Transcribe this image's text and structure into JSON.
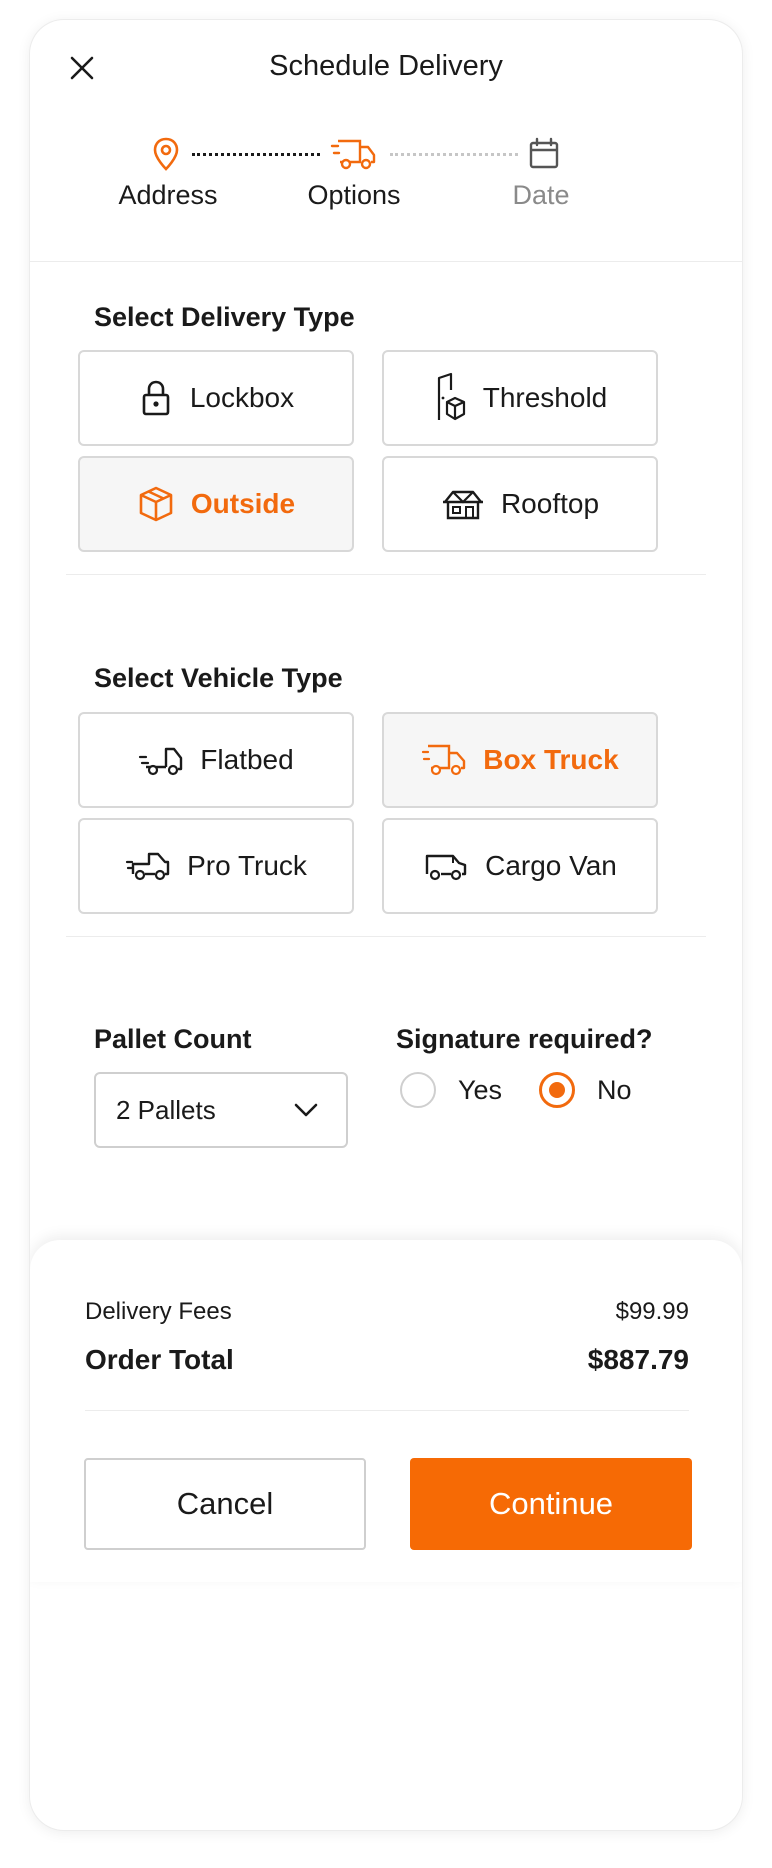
{
  "header": {
    "title": "Schedule Delivery",
    "steps": [
      {
        "label": "Address",
        "state": "done",
        "icon": "location-pin-icon"
      },
      {
        "label": "Options",
        "state": "active",
        "icon": "delivery-truck-icon"
      },
      {
        "label": "Date",
        "state": "upcoming",
        "icon": "calendar-icon"
      }
    ]
  },
  "delivery_type": {
    "title": "Select Delivery Type",
    "options": [
      {
        "label": "Lockbox",
        "icon": "lock-icon",
        "selected": false
      },
      {
        "label": "Threshold",
        "icon": "door-package-icon",
        "selected": false
      },
      {
        "label": "Outside",
        "icon": "package-icon",
        "selected": true
      },
      {
        "label": "Rooftop",
        "icon": "rooftop-icon",
        "selected": false
      }
    ]
  },
  "vehicle_type": {
    "title": "Select Vehicle Type",
    "options": [
      {
        "label": "Flatbed",
        "icon": "flatbed-truck-icon",
        "selected": false
      },
      {
        "label": "Box Truck",
        "icon": "box-truck-icon",
        "selected": true
      },
      {
        "label": "Pro Truck",
        "icon": "pickup-truck-icon",
        "selected": false
      },
      {
        "label": "Cargo Van",
        "icon": "cargo-van-icon",
        "selected": false
      }
    ]
  },
  "pallet": {
    "title": "Pallet Count",
    "selected": "2 Pallets"
  },
  "signature": {
    "title": "Signature required?",
    "options": [
      {
        "label": "Yes",
        "checked": false
      },
      {
        "label": "No",
        "checked": true
      }
    ]
  },
  "summary": {
    "fees_label": "Delivery Fees",
    "fees_value": "$99.99",
    "total_label": "Order Total",
    "total_value": "$887.79"
  },
  "actions": {
    "cancel": "Cancel",
    "continue": "Continue"
  },
  "colors": {
    "accent": "#f26a0e",
    "button": "#f66a05",
    "muted": "#8a8a8a"
  }
}
